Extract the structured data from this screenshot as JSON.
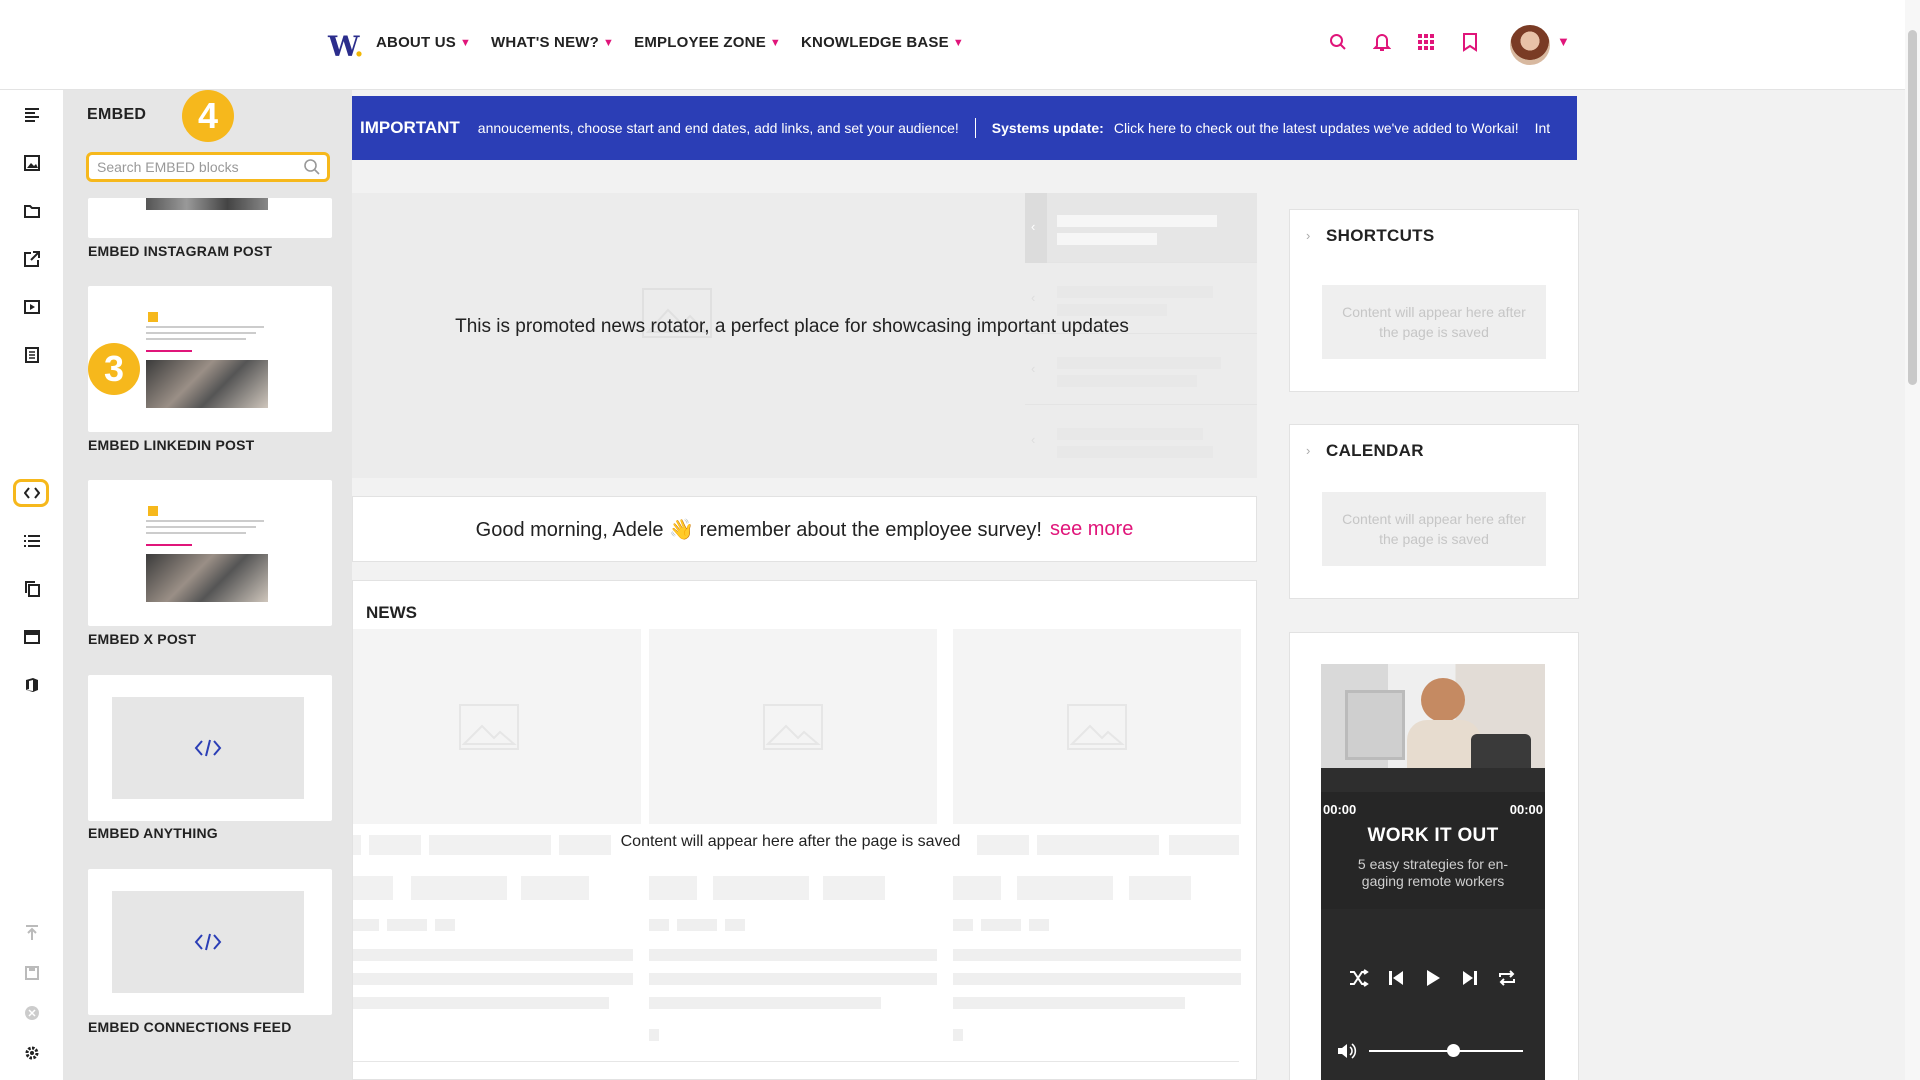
{
  "header": {
    "logo": "W",
    "nav": [
      {
        "label": "ABOUT US"
      },
      {
        "label": "WHAT'S NEW?"
      },
      {
        "label": "EMPLOYEE ZONE"
      },
      {
        "label": "KNOWLEDGE BASE"
      }
    ]
  },
  "rail": {
    "icons": [
      "paragraph-icon",
      "image-icon",
      "folder-icon",
      "external-link-icon",
      "video-icon",
      "document-list-icon",
      "code-icon",
      "list-icon",
      "copy-icon",
      "window-icon",
      "office-icon"
    ],
    "bottom_icons": [
      "publish-icon",
      "save-icon",
      "close-icon",
      "settings-icon"
    ]
  },
  "panel": {
    "title": "EMBED",
    "step_panel": "4",
    "step_rail": "3",
    "search_placeholder": "Search EMBED blocks",
    "items": [
      {
        "label": "EMBED INSTAGRAM POST"
      },
      {
        "label": "EMBED LINKEDIN POST"
      },
      {
        "label": "EMBED X POST"
      },
      {
        "label": "EMBED ANYTHING"
      },
      {
        "label": "EMBED CONNECTIONS FEED"
      }
    ]
  },
  "banner": {
    "important": "IMPORTANT",
    "text1": "annoucements, choose start and end dates, add links, and set your audience!",
    "systems_label": "Systems update:",
    "text2": "Click here to check out the latest updates we've added to Workai!",
    "text3": "Int"
  },
  "rotator": {
    "text": "This is promoted news rotator, a perfect place for showcasing important updates"
  },
  "greeting": {
    "text": "Good morning, Adele 👋 remember about the employee survey!",
    "link": "see more"
  },
  "news": {
    "title": "NEWS",
    "message": "Content will appear here after the page is saved"
  },
  "widgets": {
    "shortcuts": {
      "title": "SHORTCUTS",
      "placeholder": "Content will appear here after the page is saved"
    },
    "calendar": {
      "title": "CALENDAR",
      "placeholder": "Content will appear here after the page is saved"
    }
  },
  "player": {
    "time_current": "00:00",
    "time_total": "00:00",
    "title": "WORK IT OUT",
    "subtitle": "5 easy strategies for en-gaging remote workers",
    "volume": 0.55
  },
  "colors": {
    "accent": "#e0157a",
    "highlight": "#f6b81c",
    "banner": "#2b3eb6",
    "logo": "#2b2d8c"
  }
}
